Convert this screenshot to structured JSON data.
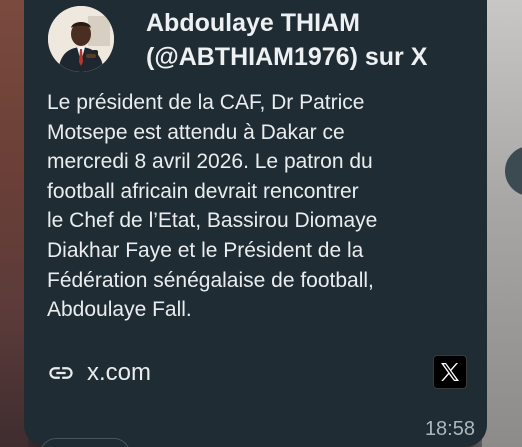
{
  "message": {
    "author": "Abdoulaye THIAM (@ABTHIAM1976) sur X",
    "description": "Le président de la CAF, Dr Patrice\nMotsepe est attendu à Dakar ce\nmercredi 8 avril 2026. Le patron du\nfootball africain devrait rencontrer\nle Chef de l’Etat, Bassirou Diomaye\nDiakhar Faye et le Président de la\nFédération sénégalaise de football,\nAbdoulaye Fall.",
    "link_text": "x.com",
    "time": "18:58"
  },
  "icons": {
    "link": "link-icon",
    "brand": "x-logo-icon",
    "avatar": "avatar"
  },
  "colors": {
    "bubble": "#1f2c33",
    "text": "#e9edef",
    "time": "#aeb6bb"
  }
}
